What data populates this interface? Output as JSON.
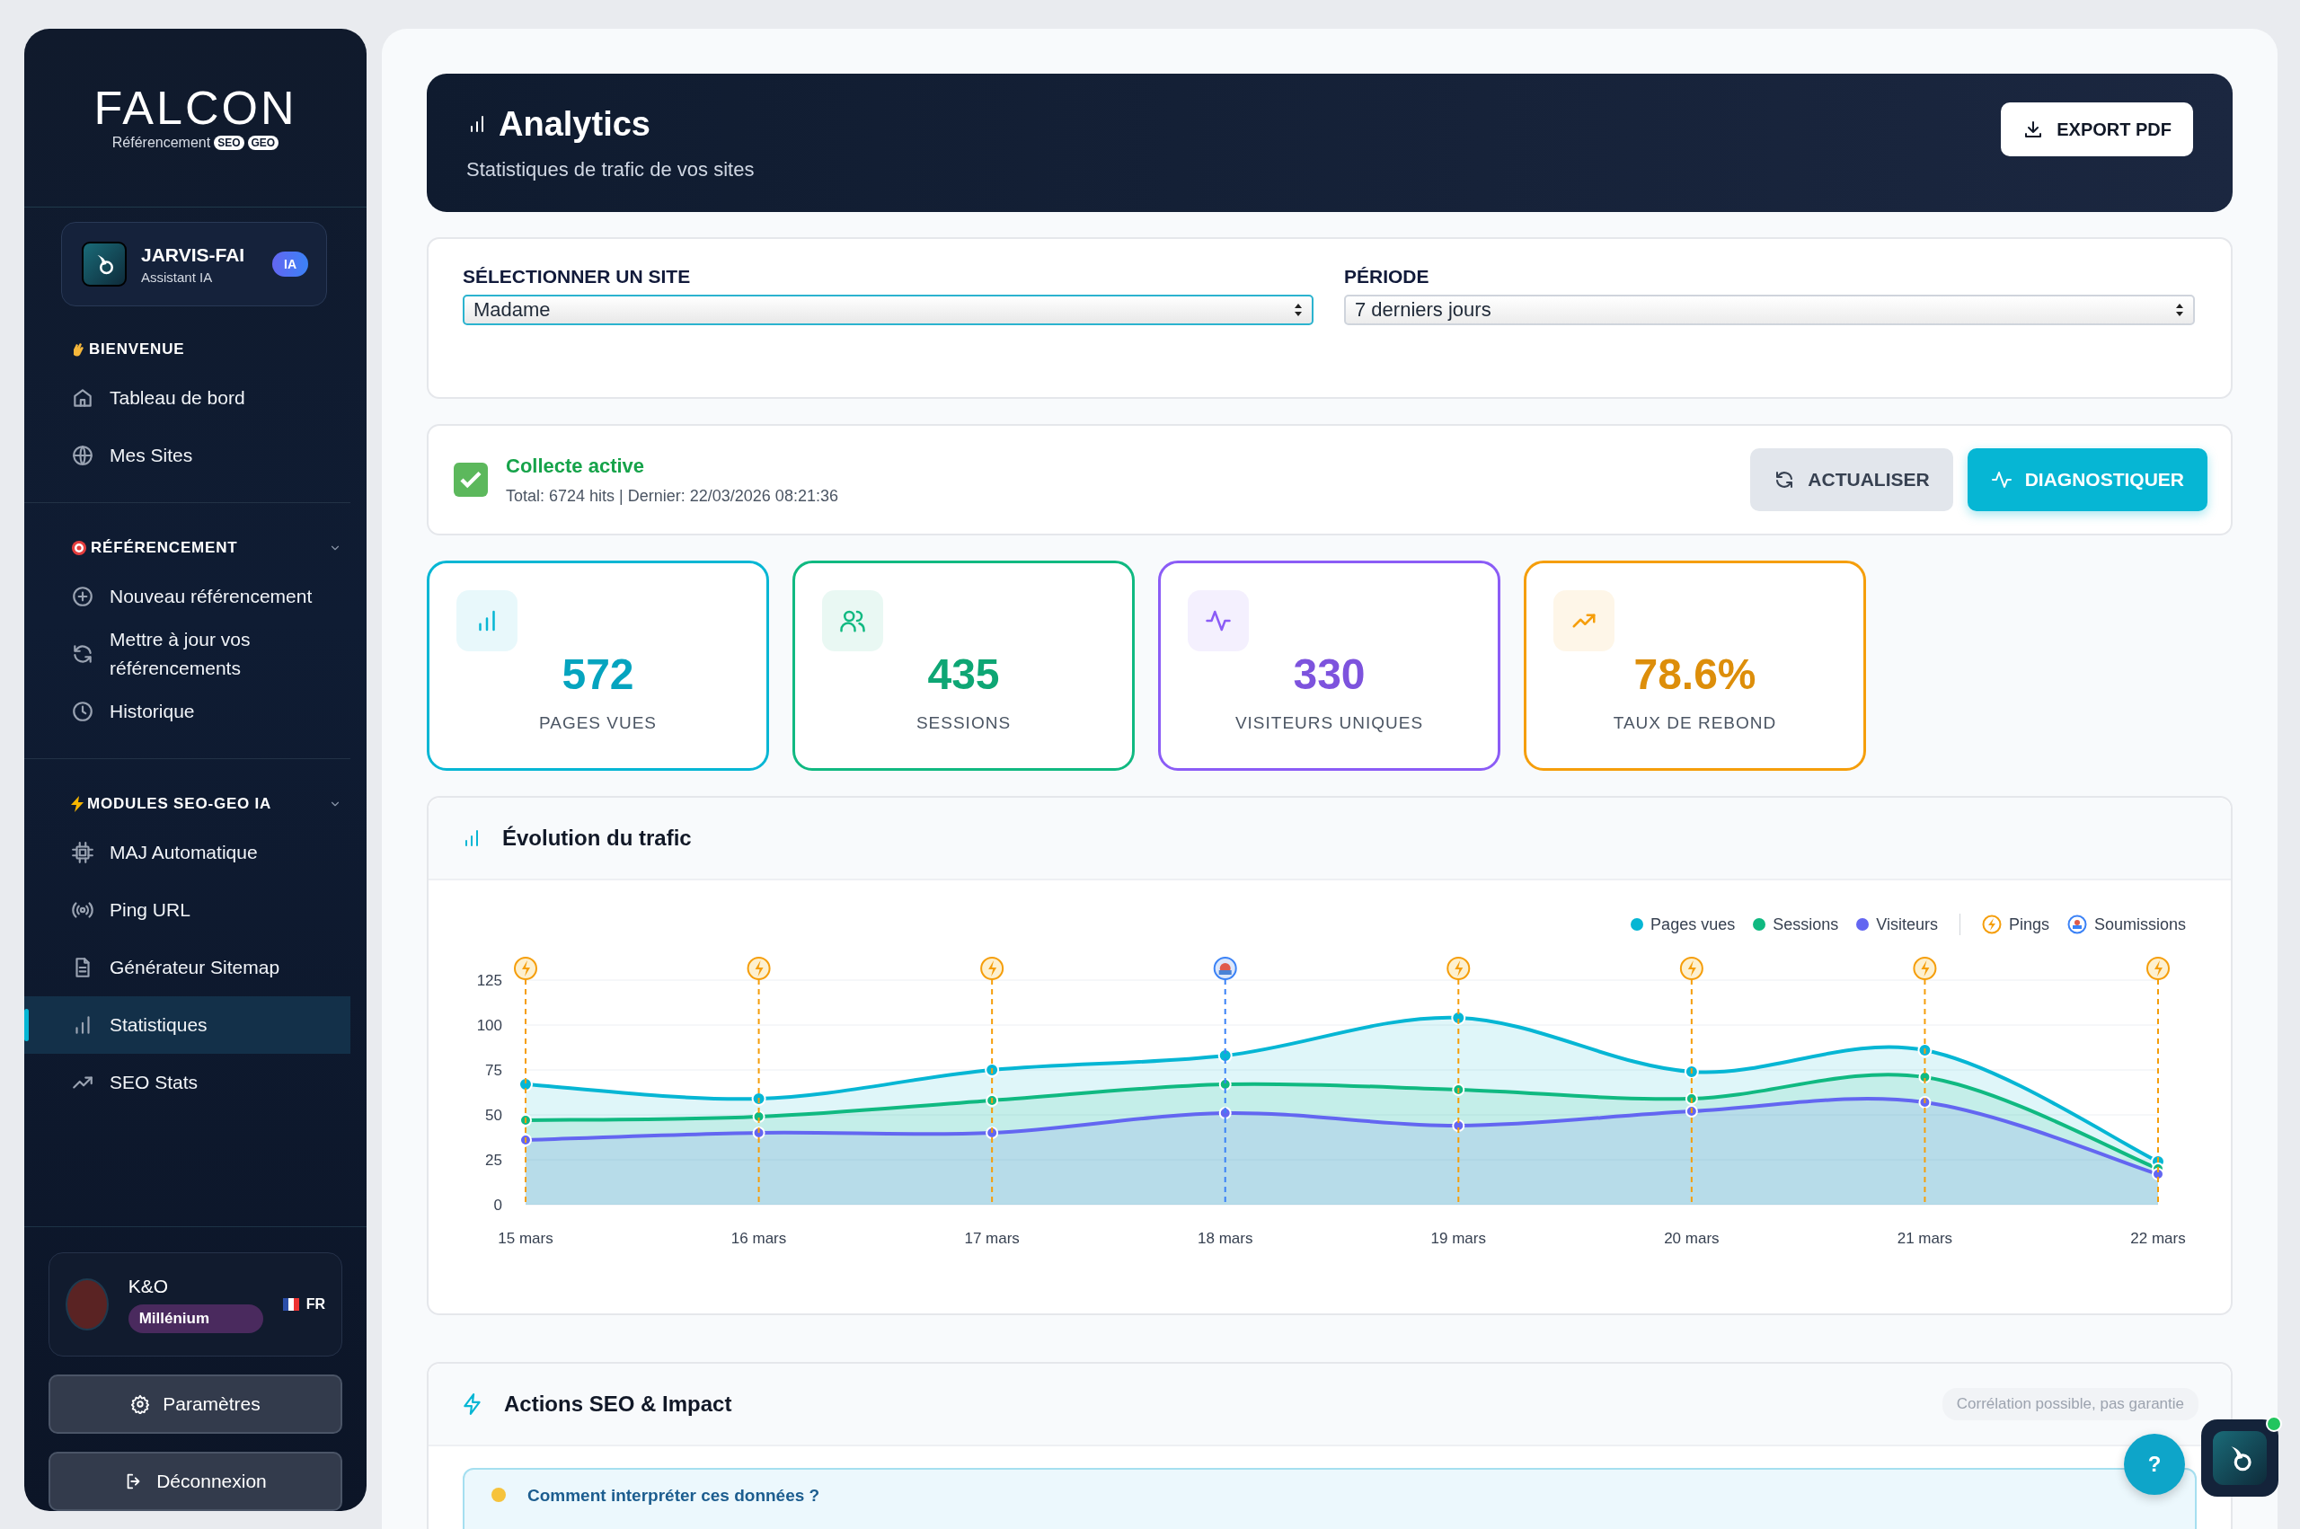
{
  "sidebar": {
    "logo": {
      "name": "FALCON",
      "tagline": "Référencement",
      "badges": [
        "SEO",
        "GEO"
      ]
    },
    "assistant": {
      "name": "JARVIS-FAI",
      "role": "Assistant IA",
      "badge": "IA"
    },
    "sections": [
      {
        "title": "BIENVENUE",
        "kind": "static",
        "items": [
          {
            "label": "Tableau de bord",
            "selected": false
          },
          {
            "label": "Mes Sites",
            "selected": false
          }
        ]
      },
      {
        "title": "RÉFÉRENCEMENT",
        "kind": "collapsible",
        "expanded": true,
        "items": [
          {
            "label": "Nouveau référencement",
            "selected": false
          },
          {
            "label": "Mettre à jour vos référencements",
            "selected": false
          },
          {
            "label": "Historique",
            "selected": false
          }
        ]
      },
      {
        "title": "MODULES SEO-GEO IA",
        "kind": "collapsible",
        "expanded": true,
        "items": [
          {
            "label": "MAJ Automatique",
            "selected": false
          },
          {
            "label": "Ping URL",
            "selected": false
          },
          {
            "label": "Générateur Sitemap",
            "selected": false
          },
          {
            "label": "Statistiques",
            "selected": true
          },
          {
            "label": "SEO Stats",
            "selected": false
          }
        ]
      }
    ],
    "user": {
      "name": "K&O",
      "plan": "Millénium",
      "lang": "FR"
    },
    "buttons": [
      "Paramètres",
      "Déconnexion"
    ]
  },
  "header": {
    "title": "Analytics",
    "subtitle": "Statistiques de trafic de vos sites",
    "export_button": "EXPORT PDF"
  },
  "filters": [
    {
      "label": "SÉLECTIONNER UN SITE",
      "value": "Madame",
      "focused": true
    },
    {
      "label": "PÉRIODE",
      "value": "7 derniers jours",
      "focused": false
    }
  ],
  "status": {
    "checked": true,
    "title": "Collecte active",
    "detail": "Total: 6724 hits | Dernier: 22/03/2026 08:21:36",
    "buttons": [
      {
        "label": "ACTUALISER",
        "kind": "secondary"
      },
      {
        "label": "DIAGNOSTIQUER",
        "kind": "primary"
      }
    ]
  },
  "stats": [
    {
      "value": "572",
      "label": "PAGES VUES",
      "color": "#06b6d4"
    },
    {
      "value": "435",
      "label": "SESSIONS",
      "color": "#10b981"
    },
    {
      "value": "330",
      "label": "VISITEURS UNIQUES",
      "color": "#8b5cf6"
    },
    {
      "value": "78.6%",
      "label": "TAUX DE REBOND",
      "color": "#f59e0b"
    }
  ],
  "traffic": {
    "title": "Évolution du trafic",
    "marker_legend": [
      {
        "label": "Pings",
        "kind": "ping",
        "color": "#f59e0b"
      },
      {
        "label": "Soumissions",
        "kind": "submission",
        "color": "#3b82f6"
      }
    ],
    "chart_data": {
      "type": "area",
      "categories": [
        "15 mars",
        "16 mars",
        "17 mars",
        "18 mars",
        "19 mars",
        "20 mars",
        "21 mars",
        "22 mars"
      ],
      "series": [
        {
          "name": "Pages vues",
          "color": "#06b6d4",
          "values": [
            67,
            59,
            75,
            83,
            104,
            74,
            86,
            24
          ]
        },
        {
          "name": "Sessions",
          "color": "#10b981",
          "values": [
            47,
            49,
            58,
            67,
            64,
            59,
            71,
            20
          ]
        },
        {
          "name": "Visiteurs",
          "color": "#6366f1",
          "values": [
            36,
            40,
            40,
            51,
            44,
            52,
            57,
            17
          ]
        }
      ],
      "ylim": [
        0,
        125
      ],
      "yticks": [
        0,
        25,
        50,
        75,
        100,
        125
      ],
      "grid": true,
      "annotations": [
        {
          "x": "15 mars"
        },
        {
          "x": "16 mars"
        },
        {
          "x": "17 mars"
        },
        {
          "x": "18 mars"
        },
        {
          "x": "19 mars"
        },
        {
          "x": "20 mars"
        },
        {
          "x": "21 mars"
        },
        {
          "x": "22 mars"
        }
      ]
    },
    "event_markers": [
      {
        "kind": "ping"
      },
      {
        "kind": "ping"
      },
      {
        "kind": "ping"
      },
      {
        "kind": "submission"
      },
      {
        "kind": "ping"
      },
      {
        "kind": "ping"
      },
      {
        "kind": "ping"
      },
      {
        "kind": "ping"
      }
    ]
  },
  "actions": {
    "title": "Actions SEO & Impact",
    "note": "Corrélation possible, pas garantie",
    "tip_title": "Comment interpréter ces données ?"
  },
  "help_button": "?"
}
